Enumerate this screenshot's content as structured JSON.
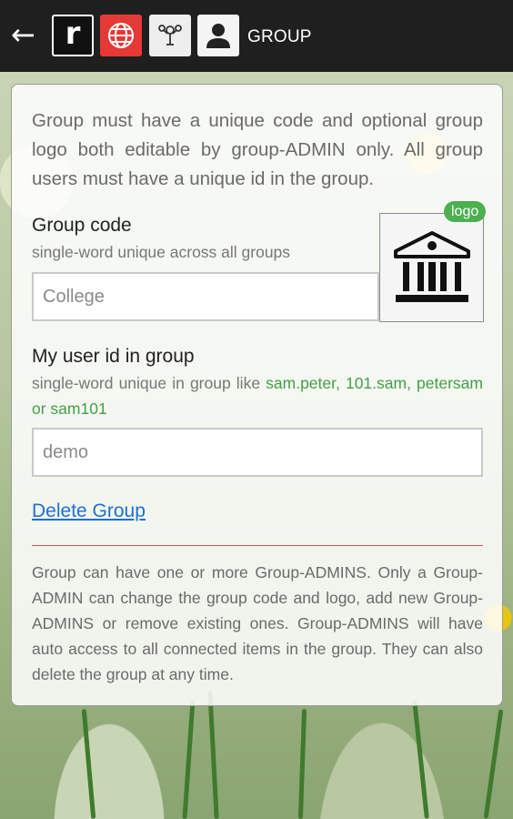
{
  "header": {
    "back_icon": "arrow-left-icon",
    "app_logo_letter": "r",
    "title": "GROUP",
    "buttons": [
      "globe-icon",
      "network-icon",
      "user-icon"
    ]
  },
  "card": {
    "intro": "Group must have a unique code and optional group logo both editable by group-ADMIN only. All group users must have a unique id in the group.",
    "group_code_label": "Group code",
    "group_code_hint": "single-word unique across all groups",
    "group_code_value": "College",
    "logo_badge": "logo",
    "logo_icon": "institution-icon",
    "user_id_label": "My user id in group",
    "user_id_hint_prefix": "single-word unique in group like ",
    "user_id_examples": "sam.peter, 101.sam, petersam or sam101",
    "user_id_value": "demo",
    "delete_link": "Delete Group",
    "info": "Group can have one or more Group-ADMINS. Only a Group-ADMIN can change the group code and logo, add new Group-ADMINS or remove existing ones. Group-ADMINS will have auto access to all connected items in the group. They can also delete the group at any time."
  },
  "colors": {
    "header_bg": "#1f1f1f",
    "globe_button": "#e53935",
    "accent_green": "#43a047",
    "link_blue": "#1e6fd0",
    "divider_red": "#d9534f"
  }
}
